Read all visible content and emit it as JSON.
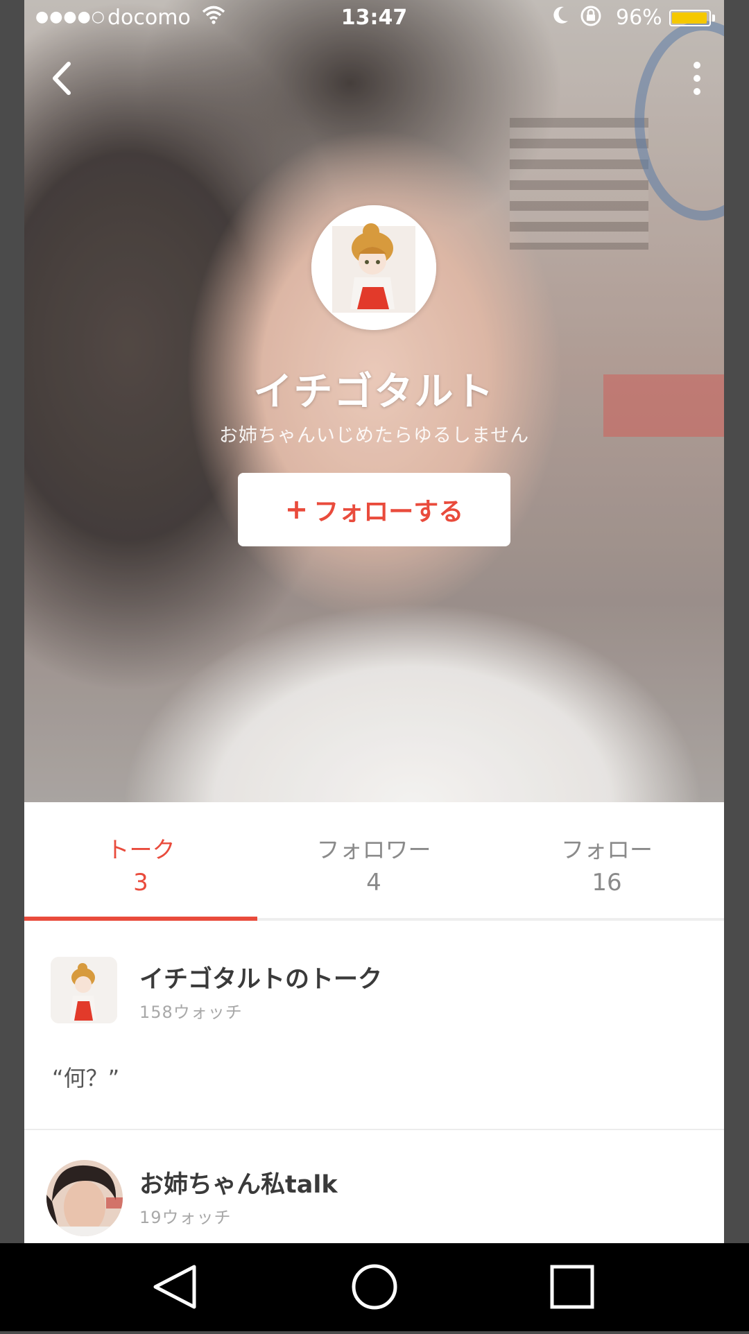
{
  "status_bar": {
    "signal": "●●●●○",
    "carrier": "docomo",
    "time": "13:47",
    "battery_percent": "96%",
    "battery_level": 0.96
  },
  "profile": {
    "name": "イチゴタルト",
    "bio": "お姉ちゃんいじめたらゆるしません",
    "follow_button": {
      "plus": "+",
      "label": "フォローする"
    }
  },
  "tabs": [
    {
      "label": "トーク",
      "count": "3",
      "active": true
    },
    {
      "label": "フォロワー",
      "count": "4",
      "active": false
    },
    {
      "label": "フォロー",
      "count": "16",
      "active": false
    }
  ],
  "talks": [
    {
      "title": "イチゴタルトのトーク",
      "watchers": "158ウォッチ",
      "quote": "“何？”"
    },
    {
      "title": "お姉ちゃん私talk",
      "watchers": "19ウォッチ"
    }
  ],
  "colors": {
    "accent": "#e94b3c",
    "tab_inactive": "#8a8a8a",
    "battery": "#f5c800"
  },
  "icons": {
    "back": "chevron-left-icon",
    "more": "more-vertical-icon",
    "nav_back": "triangle-back-icon",
    "nav_home": "circle-home-icon",
    "nav_recents": "square-recents-icon"
  }
}
